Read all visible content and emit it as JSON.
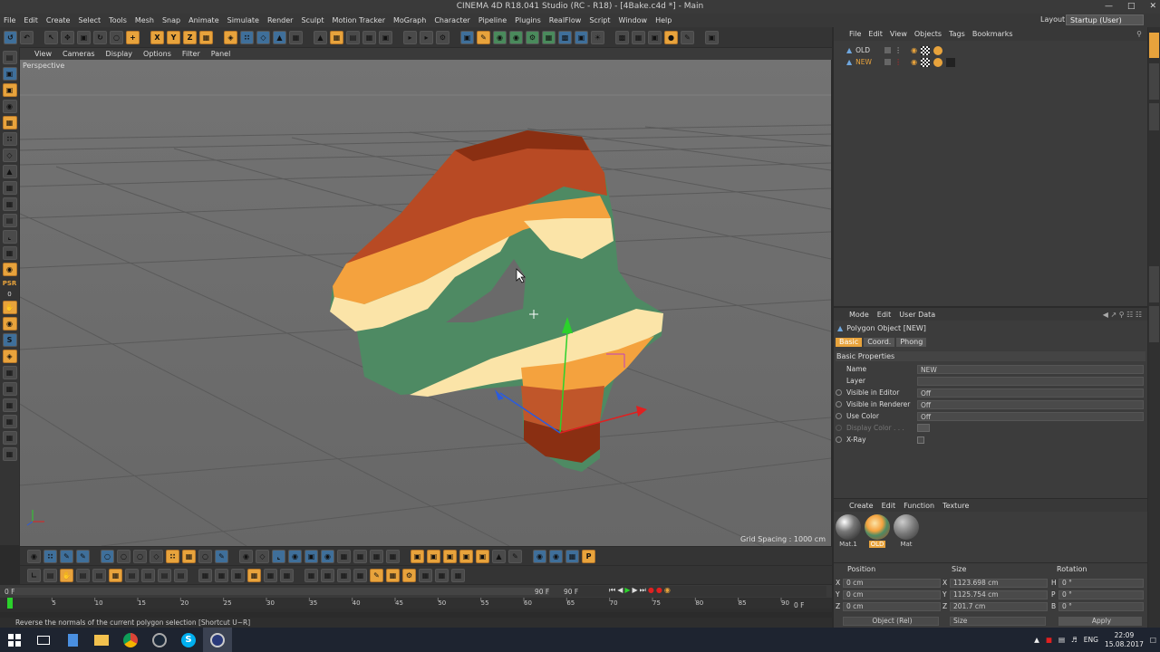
{
  "window": {
    "title": "CINEMA 4D R18.041 Studio (RC - R18) - [4Bake.c4d *] - Main"
  },
  "menubar": [
    "File",
    "Edit",
    "Create",
    "Select",
    "Tools",
    "Mesh",
    "Snap",
    "Animate",
    "Simulate",
    "Render",
    "Sculpt",
    "Motion Tracker",
    "MoGraph",
    "Character",
    "Pipeline",
    "Plugins",
    "RealFlow",
    "Script",
    "Window",
    "Help"
  ],
  "layout": {
    "label": "Layout:",
    "value": "Startup (User)"
  },
  "toolbar": {
    "axis_x": "X",
    "axis_y": "Y",
    "axis_z": "Z"
  },
  "lefttools": {
    "psr_label": "PSR",
    "psr_value": "0"
  },
  "viewport": {
    "menu": [
      "View",
      "Cameras",
      "Display",
      "Options",
      "Filter",
      "Panel"
    ],
    "label": "Perspective",
    "grid_spacing": "Grid Spacing : 1000 cm"
  },
  "object_manager": {
    "menu": [
      "File",
      "Edit",
      "View",
      "Objects",
      "Tags",
      "Bookmarks"
    ],
    "objects": [
      {
        "name": "OLD"
      },
      {
        "name": "NEW"
      }
    ]
  },
  "attributes": {
    "menu": [
      "Mode",
      "Edit",
      "User Data"
    ],
    "title": "Polygon Object [NEW]",
    "tabs": [
      "Basic",
      "Coord.",
      "Phong"
    ],
    "section": "Basic Properties",
    "name_label": "Name",
    "name_value": "NEW",
    "layer_label": "Layer",
    "visible_editor_label": "Visible in Editor",
    "visible_editor_value": "Off",
    "visible_renderer_label": "Visible in Renderer",
    "visible_renderer_value": "Off",
    "use_color_label": "Use Color",
    "use_color_value": "Off",
    "display_color_label": "Display Color . . .",
    "xray_label": "X-Ray"
  },
  "materials": {
    "menu": [
      "Create",
      "Edit",
      "Function",
      "Texture"
    ],
    "items": [
      {
        "name": "Mat.1"
      },
      {
        "name": "OLD"
      },
      {
        "name": "Mat"
      }
    ]
  },
  "coordinates": {
    "headers": {
      "position": "Position",
      "size": "Size",
      "rotation": "Rotation"
    },
    "rows": [
      {
        "axis": "X",
        "pos": "0 cm",
        "size_axis": "X",
        "size": "1123.698 cm",
        "rot_axis": "H",
        "rot": "0 °"
      },
      {
        "axis": "Y",
        "pos": "0 cm",
        "size_axis": "Y",
        "size": "1125.754 cm",
        "rot_axis": "P",
        "rot": "0 °"
      },
      {
        "axis": "Z",
        "pos": "0 cm",
        "size_axis": "Z",
        "size": "201.7 cm",
        "rot_axis": "B",
        "rot": "0 °"
      }
    ],
    "mode": "Object (Rel)",
    "size_mode": "Size",
    "apply": "Apply"
  },
  "timeline": {
    "ticks": [
      "0",
      "5",
      "10",
      "15",
      "20",
      "25",
      "30",
      "35",
      "40",
      "45",
      "50",
      "55",
      "60",
      "65",
      "70",
      "75",
      "80",
      "85",
      "90"
    ],
    "start_frame": "0 F",
    "end_frame": "90 F",
    "end_frame2": "90 F",
    "current_frame": "0 F",
    "frame_right": "0 F"
  },
  "status": "Reverse the normals of the current polygon selection [Shortcut U~R]",
  "taskbar": {
    "lang": "ENG",
    "time": "22:09",
    "date": "15.08.2017"
  }
}
